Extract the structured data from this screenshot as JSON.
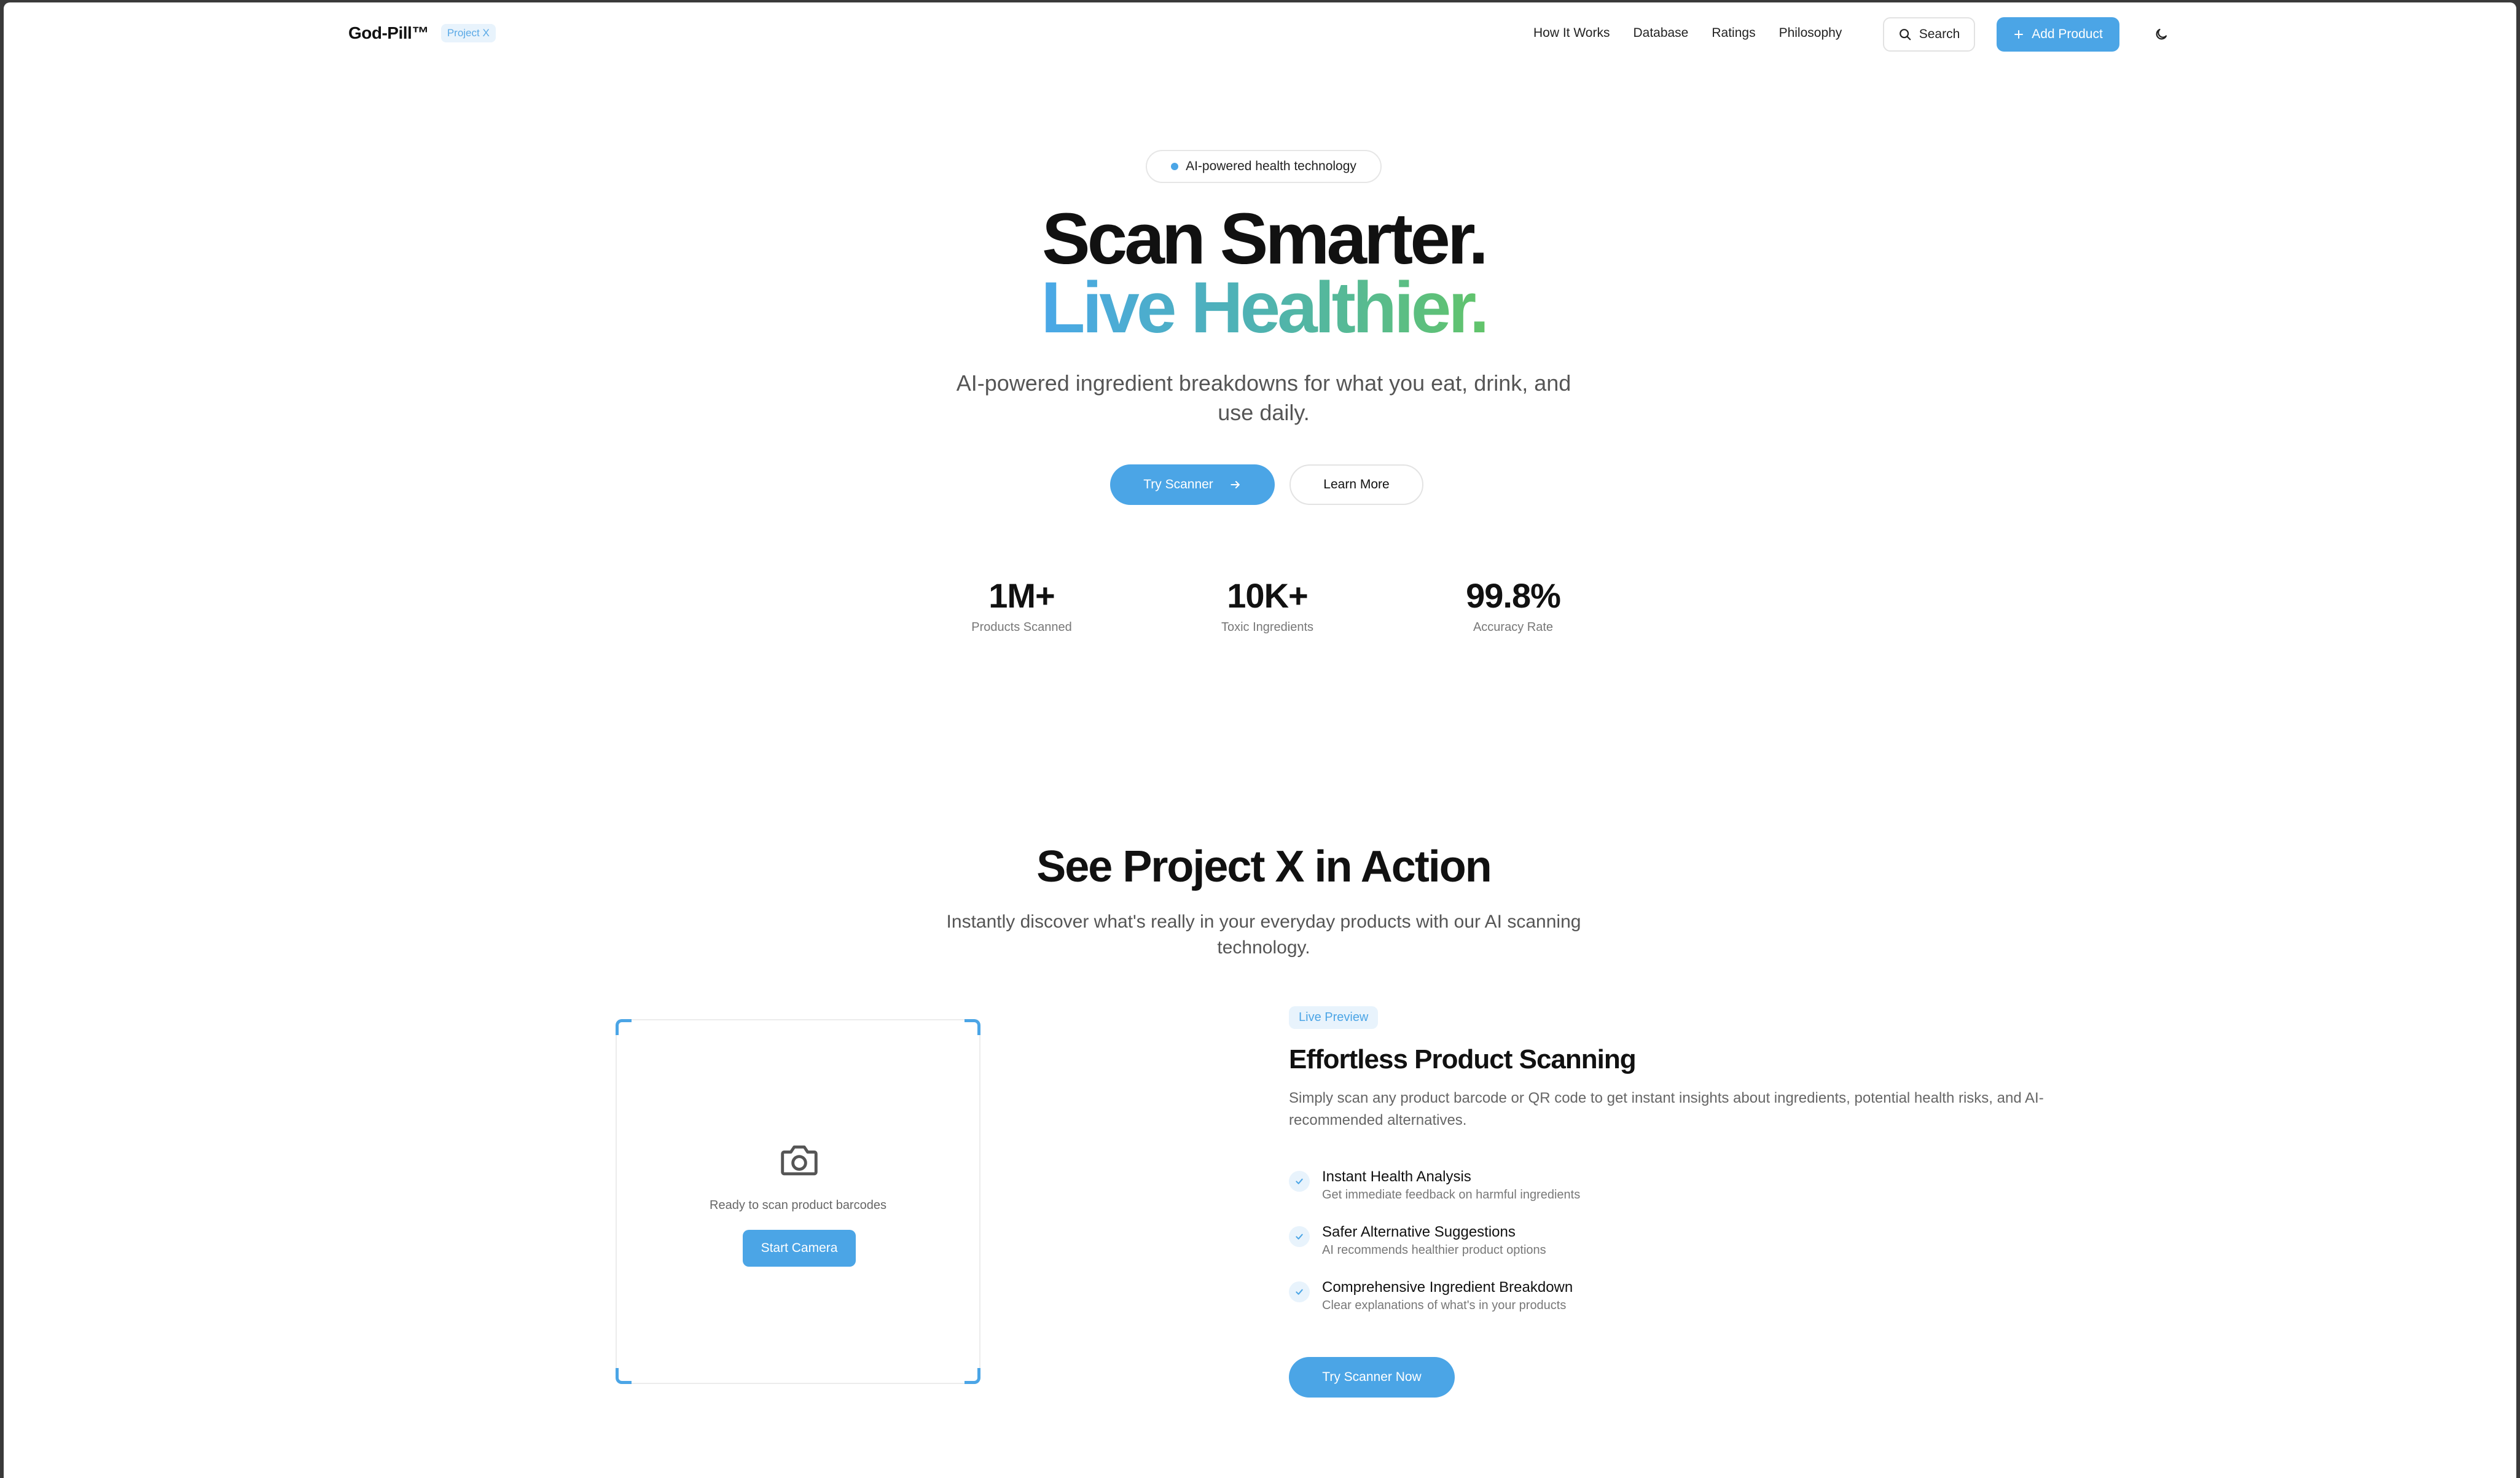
{
  "nav": {
    "brand": "God-Pill™",
    "badge": "Project X",
    "links": [
      "How It Works",
      "Database",
      "Ratings",
      "Philosophy"
    ],
    "search_label": "Search",
    "add_label": "Add Product",
    "icons": {
      "search": "search-icon",
      "add": "plus-icon",
      "theme": "moon-icon"
    }
  },
  "hero": {
    "pill": "AI-powered health technology",
    "title_line1": "Scan Smarter.",
    "title_line2": "Live Healthier.",
    "subtitle": "AI-powered ingredient breakdowns for what you eat, drink, and use daily.",
    "primary_cta": "Try Scanner",
    "secondary_cta": "Learn More",
    "stats": [
      {
        "value": "1M+",
        "label": "Products Scanned"
      },
      {
        "value": "10K+",
        "label": "Toxic Ingredients"
      },
      {
        "value": "99.8%",
        "label": "Accuracy Rate"
      }
    ]
  },
  "demo": {
    "title": "See Project X in Action",
    "subtitle": "Instantly discover what's really in your everyday products with our AI scanning technology.",
    "scanner": {
      "status": "Ready to scan product barcodes",
      "button": "Start Camera"
    },
    "badge": "Live Preview",
    "feature_title": "Effortless Product Scanning",
    "feature_desc": "Simply scan any product barcode or QR code to get instant insights about ingredients, potential health risks, and AI-recommended alternatives.",
    "features": [
      {
        "title": "Instant Health Analysis",
        "sub": "Get immediate feedback on harmful ingredients"
      },
      {
        "title": "Safer Alternative Suggestions",
        "sub": "AI recommends healthier product options"
      },
      {
        "title": "Comprehensive Ingredient Breakdown",
        "sub": "Clear explanations of what's in your products"
      }
    ],
    "cta": "Try Scanner Now"
  },
  "colors": {
    "accent": "#4ba5e6",
    "gradient_start": "#4aa8e8",
    "gradient_end": "#62c46a"
  }
}
